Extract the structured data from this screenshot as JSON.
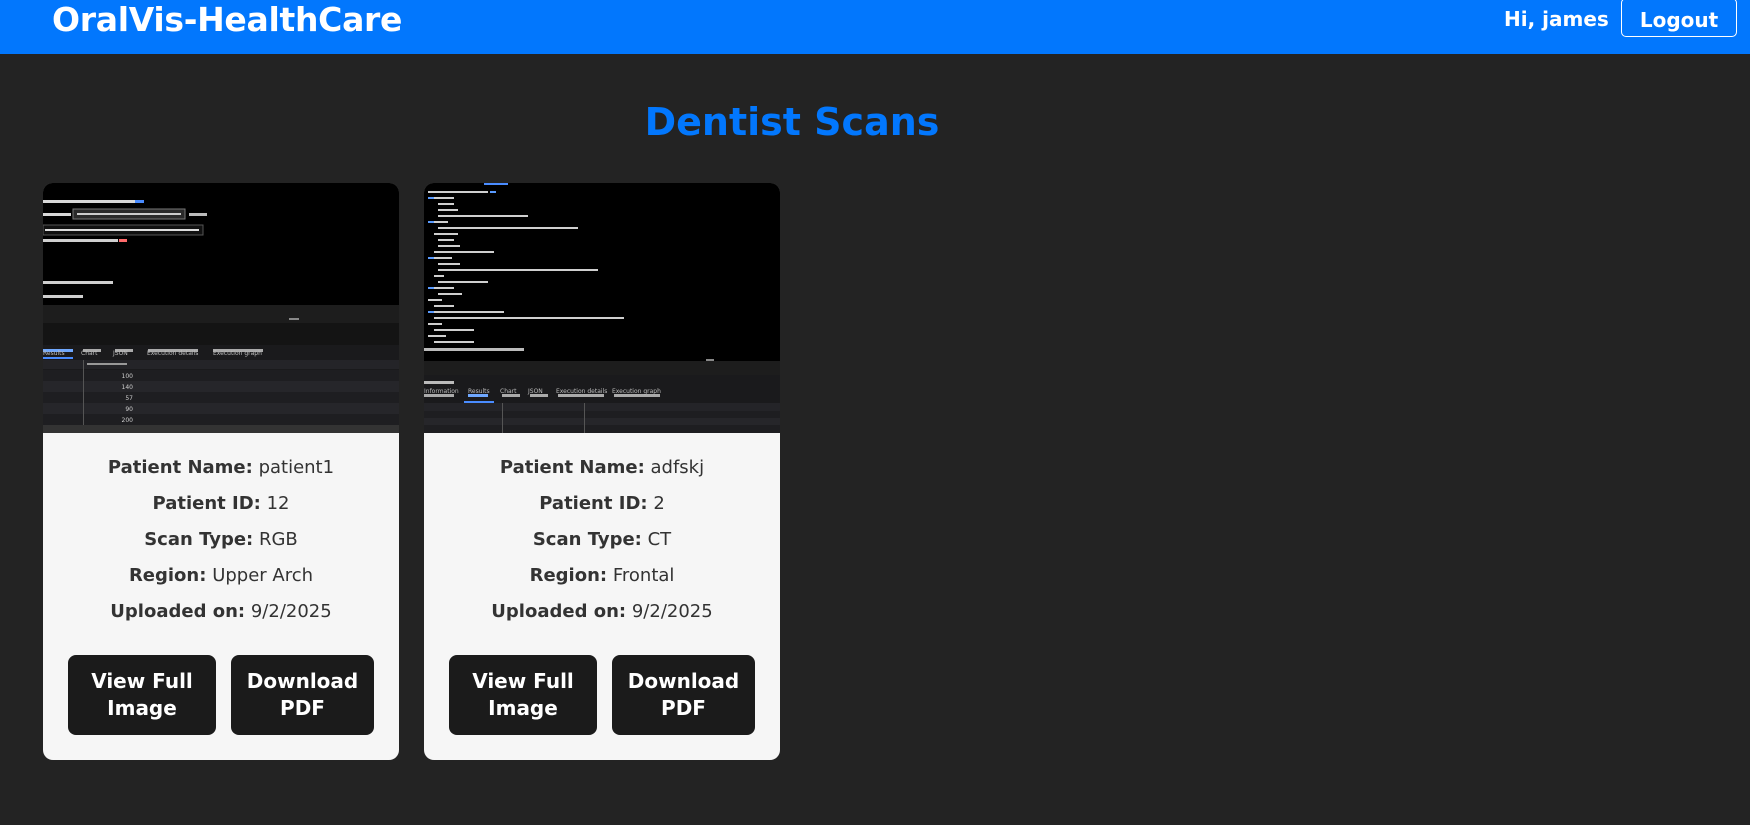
{
  "navbar": {
    "brand": "OralVis-HealthCare",
    "greeting": "Hi, james",
    "logout_label": "Logout"
  },
  "page": {
    "title": "Dentist Scans"
  },
  "labels": {
    "patient_name": "Patient Name:",
    "patient_id": "Patient ID:",
    "scan_type": "Scan Type:",
    "region": "Region:",
    "uploaded_on": "Uploaded on:"
  },
  "buttons": {
    "view_line1": "View Full",
    "view_line2": "Image",
    "pdf_line1": "Download",
    "pdf_line2": "PDF"
  },
  "scans": [
    {
      "patient_name": "patient1",
      "patient_id": "12",
      "scan_type": "RGB",
      "region": "Upper Arch",
      "uploaded_on": "9/2/2025",
      "thumb_tabs": [
        "Results",
        "Chart",
        "JSON",
        "Execution details",
        "Execution graph"
      ],
      "thumb_values": [
        "100",
        "140",
        "57",
        "90",
        "200"
      ]
    },
    {
      "patient_name": "adfskj",
      "patient_id": "2",
      "scan_type": "CT",
      "region": "Frontal",
      "uploaded_on": "9/2/2025",
      "thumb_tabs": [
        "Information",
        "Results",
        "Chart",
        "JSON",
        "Execution details",
        "Execution graph"
      ],
      "thumb_values": []
    }
  ]
}
